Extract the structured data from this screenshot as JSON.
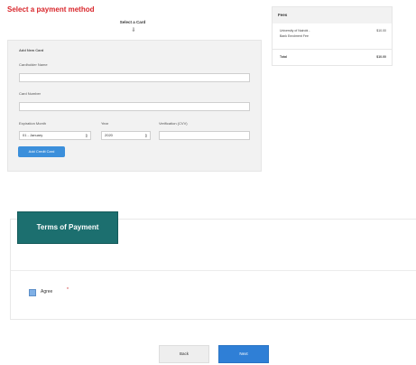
{
  "page": {
    "title": "Select a payment method",
    "title_color": "#d9262b",
    "card_heading": "Select a Card",
    "card_heading_arrow": "⇩"
  },
  "card_form": {
    "heading": "Add New Card",
    "cardholder_label": "Cardholder Name",
    "cardholder_value": "",
    "card_number_label": "Card Number",
    "card_number_value": "",
    "expiration_month_label": "Expiration Month",
    "expiration_month_value": "01 - January",
    "year_label": "Year",
    "year_value": "2020",
    "verification_label": "Verification (CVV)",
    "verification_value": "",
    "add_button_label": "Add Credit Card"
  },
  "summary": {
    "header": "Fees",
    "item_line1": "University of Nairobi -",
    "item_line2": "Bank Enrolment Fee",
    "item_amount": "$10.00",
    "total_label": "Total",
    "total_amount": "$10.00"
  },
  "terms": {
    "tab_label": "Terms of Payment",
    "agree_label": "Agree",
    "required_marker": "*"
  },
  "footer": {
    "back_label": "Back",
    "next_label": "Next"
  }
}
